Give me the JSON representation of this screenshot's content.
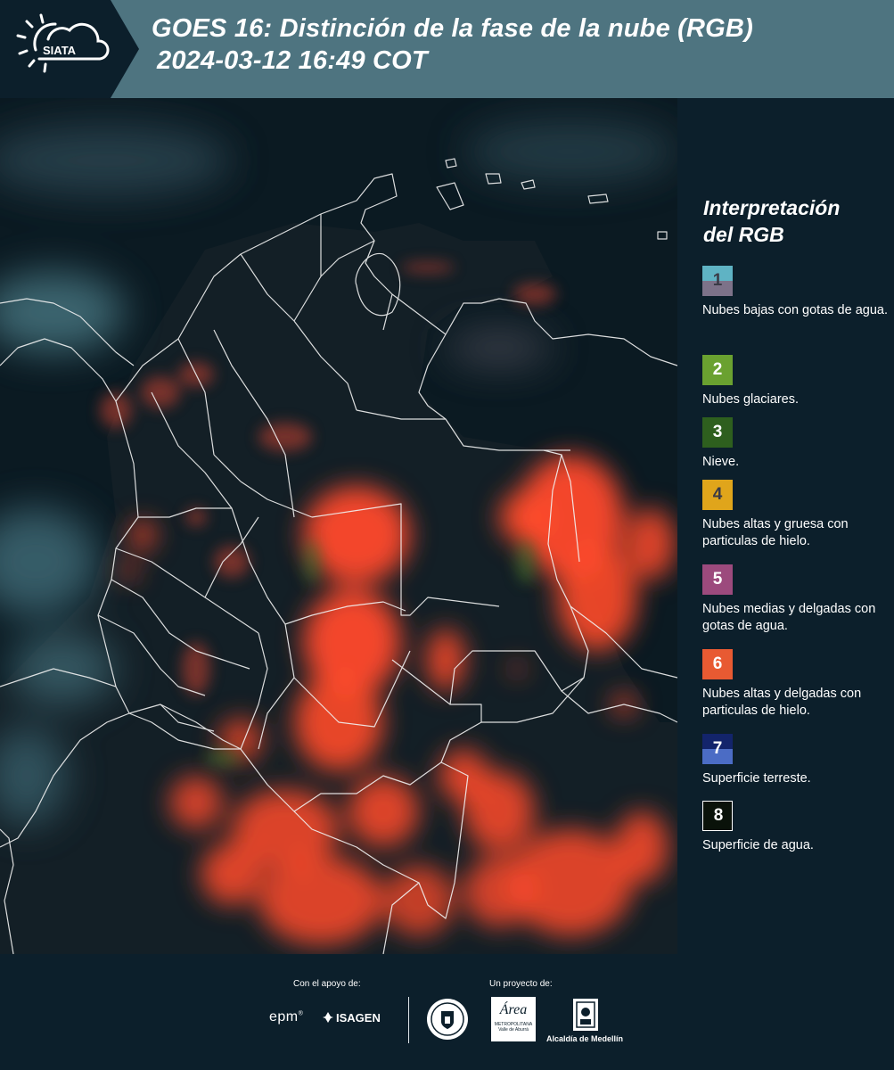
{
  "header": {
    "logo_text": "SIATA",
    "title_line1": "GOES 16: Distinción de la fase de la nube (RGB)",
    "title_line2": "2024-03-12 16:49 COT"
  },
  "legend": {
    "title_line1": "Interpretación",
    "title_line2": "del RGB",
    "items": [
      {
        "number": "1",
        "label": "Nubes bajas con gotas de agua.",
        "color_top": "#5fb3c4",
        "color_bottom": "#7d7289"
      },
      {
        "number": "2",
        "label": "Nubes glaciares.",
        "color_top": "#6aa130",
        "color_bottom": "#6aa130"
      },
      {
        "number": "3",
        "label": "Nieve.",
        "color_top": "#2e5f1e",
        "color_bottom": "#2e5f1e"
      },
      {
        "number": "4",
        "label": "Nubes altas y gruesa con particulas de hielo.",
        "color_top": "#e0a51b",
        "color_bottom": "#e0a51b"
      },
      {
        "number": "5",
        "label": "Nubes medias y delgadas con gotas de agua.",
        "color_top": "#9c4a7d",
        "color_bottom": "#9c4a7d"
      },
      {
        "number": "6",
        "label": "Nubes altas y delgadas con particulas de hielo.",
        "color_top": "#e85a32",
        "color_bottom": "#e85a32"
      },
      {
        "number": "7",
        "label": "Superficie terreste.",
        "color_top": "#13246b",
        "color_bottom": "#4b6cc5"
      },
      {
        "number": "8",
        "label": "Superficie de agua.",
        "color_top": "#0a120a",
        "color_bottom": "#0a120a"
      }
    ]
  },
  "footer": {
    "support_label": "Con el apoyo de:",
    "project_label": "Un proyecto de:",
    "sponsor1": "epm",
    "sponsor2": "ISAGEN",
    "partner_area_main": "Área",
    "partner_area_sub1": "METROPOLITANA",
    "partner_area_sub2": "Valle de Aburrá",
    "partner_alcaldia": "Alcaldía de Medellín"
  }
}
